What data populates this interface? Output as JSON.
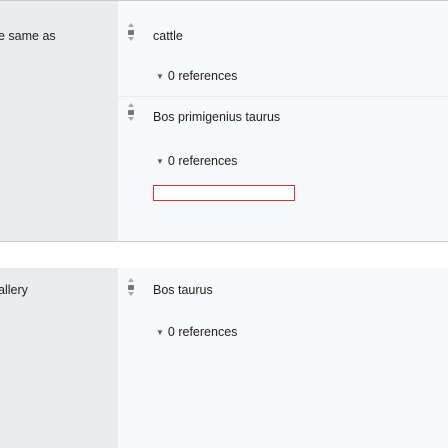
{
  "groups": [
    {
      "property": "e same as",
      "statements": [
        {
          "value": "cattle",
          "references": "0 references"
        },
        {
          "value": "Bos primigenius taurus",
          "references": "0 references"
        }
      ]
    },
    {
      "property": "allery",
      "statements": [
        {
          "value": "Bos taurus",
          "references": "0 references"
        }
      ]
    }
  ]
}
